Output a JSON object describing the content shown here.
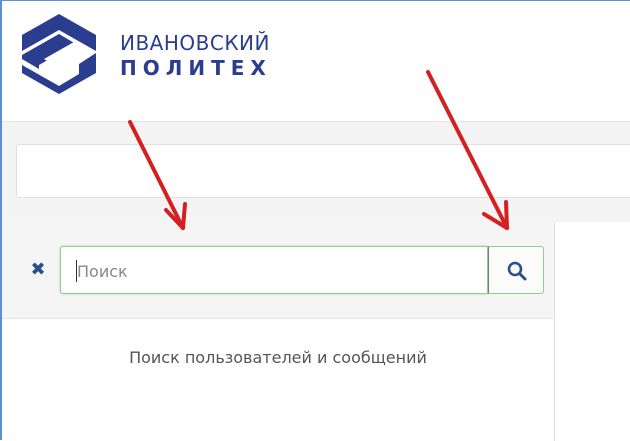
{
  "header": {
    "logo_line1": "ИВАНОВСКИЙ",
    "logo_line2": "ПОЛИТЕХ",
    "brand_color": "#2a3d8f"
  },
  "search": {
    "placeholder": "Поиск",
    "value": "",
    "button_icon": "search-icon",
    "clear_icon": "close-icon",
    "hint": "Поиск пользователей и сообщений",
    "focus_border_color": "#8ccf8c"
  },
  "annotations": {
    "arrow_color": "#d42020"
  }
}
